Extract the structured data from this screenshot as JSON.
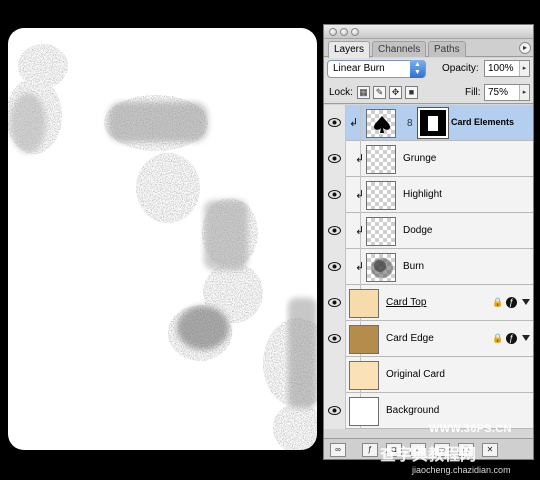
{
  "panel": {
    "tabs": [
      "Layers",
      "Channels",
      "Paths"
    ],
    "blend_mode": "Linear Burn",
    "opacity_label": "Opacity:",
    "opacity_value": "100%",
    "lock_label": "Lock:",
    "fill_label": "Fill:",
    "fill_value": "75%"
  },
  "layers": [
    {
      "name": "Card Elements",
      "visible": true,
      "clipped": true,
      "selected": true,
      "has_mask": true
    },
    {
      "name": "Grunge",
      "visible": true,
      "clipped": true
    },
    {
      "name": "Highlight",
      "visible": true,
      "clipped": true
    },
    {
      "name": "Dodge",
      "visible": true,
      "clipped": true
    },
    {
      "name": "Burn",
      "visible": true,
      "clipped": true
    },
    {
      "name": "Card Top",
      "visible": true,
      "clipped": false,
      "locked": true,
      "has_effects": true
    },
    {
      "name": "Card Edge",
      "visible": true,
      "clipped": false,
      "locked": true,
      "has_effects": true
    },
    {
      "name": "Original Card",
      "visible": false,
      "clipped": false
    },
    {
      "name": "Background",
      "visible": true,
      "clipped": false
    }
  ],
  "watermark": {
    "site": "WWW.36PS.CN",
    "cn_text": "查字典教程网",
    "url": "jiaocheng.chazidian.com"
  },
  "colors": {
    "selection": "#b4cef0",
    "card_top_thumb": "#f6dcaa",
    "card_edge_thumb": "#b48c4c",
    "blend_arrow": "#3c7bd8"
  }
}
